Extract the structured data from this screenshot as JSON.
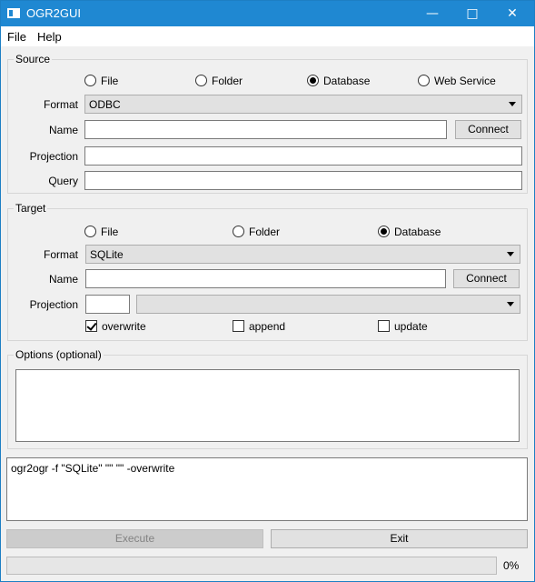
{
  "window": {
    "title": "OGR2GUI"
  },
  "menu": {
    "file": "File",
    "help": "Help"
  },
  "source": {
    "title": "Source",
    "radios": [
      {
        "label": "File",
        "checked": false
      },
      {
        "label": "Folder",
        "checked": false
      },
      {
        "label": "Database",
        "checked": true
      },
      {
        "label": "Web Service",
        "checked": false
      }
    ],
    "format_label": "Format",
    "format_value": "ODBC",
    "name_label": "Name",
    "name_value": "",
    "connect_label": "Connect",
    "projection_label": "Projection",
    "projection_value": "",
    "query_label": "Query",
    "query_value": ""
  },
  "target": {
    "title": "Target",
    "radios": [
      {
        "label": "File",
        "checked": false
      },
      {
        "label": "Folder",
        "checked": false
      },
      {
        "label": "Database",
        "checked": true
      }
    ],
    "format_label": "Format",
    "format_value": "SQLite",
    "name_label": "Name",
    "name_value": "",
    "connect_label": "Connect",
    "projection_label": "Projection",
    "projection_value": "",
    "projection_select": "",
    "checks": [
      {
        "label": "overwrite",
        "checked": true
      },
      {
        "label": "append",
        "checked": false
      },
      {
        "label": "update",
        "checked": false
      }
    ]
  },
  "options": {
    "title": "Options (optional)",
    "value": ""
  },
  "command": {
    "text": "ogr2ogr -f \"SQLite\" \"\" \"\" -overwrite"
  },
  "actions": {
    "execute_label": "Execute",
    "exit_label": "Exit"
  },
  "progress": {
    "value": 0,
    "label": "0%"
  }
}
